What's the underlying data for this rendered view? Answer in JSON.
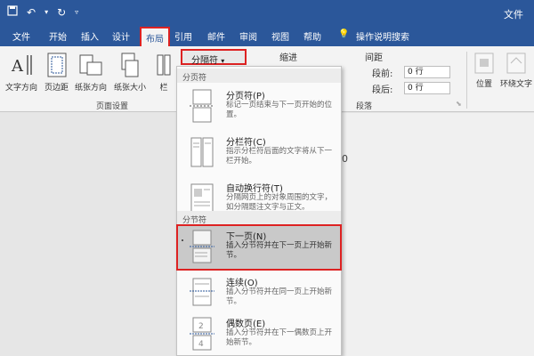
{
  "titlebar": {
    "file_label": "文件"
  },
  "tabs": [
    {
      "label": "文件"
    },
    {
      "label": "开始"
    },
    {
      "label": "插入"
    },
    {
      "label": "设计"
    },
    {
      "label": "布局"
    },
    {
      "label": "引用"
    },
    {
      "label": "邮件"
    },
    {
      "label": "审阅"
    },
    {
      "label": "视图"
    },
    {
      "label": "帮助"
    },
    {
      "label": "操作说明搜索"
    }
  ],
  "ribbon": {
    "buttons": [
      {
        "label": "文字方向"
      },
      {
        "label": "页边距"
      },
      {
        "label": "纸张方向"
      },
      {
        "label": "纸张大小"
      },
      {
        "label": "栏"
      }
    ],
    "group_page_setup": "页面设置",
    "breaks_label": "分隔符",
    "indent_label": "缩进",
    "spacing_label": "间距",
    "before_label": "段前:",
    "after_label": "段后:",
    "before_value": "0 行",
    "after_value": "0 行",
    "group_paragraph": "段落",
    "position_label": "位置",
    "wrap_label": "环绕文字"
  },
  "page": {
    "fragment_text": "0"
  },
  "dropdown": {
    "section_page": "分页符",
    "section_section": "分节符",
    "items": [
      {
        "title": "分页符(P)",
        "desc": "标记一页结束与下一页开始的位置。"
      },
      {
        "title": "分栏符(C)",
        "desc": "指示分栏符后面的文字将从下一栏开始。"
      },
      {
        "title": "自动换行符(T)",
        "desc": "分隔网页上的对象周围的文字，如分隔题注文字与正文。"
      },
      {
        "title": "下一页(N)",
        "desc": "插入分节符并在下一页上开始新节。"
      },
      {
        "title": "连续(O)",
        "desc": "插入分节符并在同一页上开始新节。"
      },
      {
        "title": "偶数页(E)",
        "desc": "插入分节符并在下一偶数页上开始新节。"
      }
    ]
  },
  "colors": {
    "accent": "#2b579a",
    "highlight_border": "#dd2222"
  }
}
